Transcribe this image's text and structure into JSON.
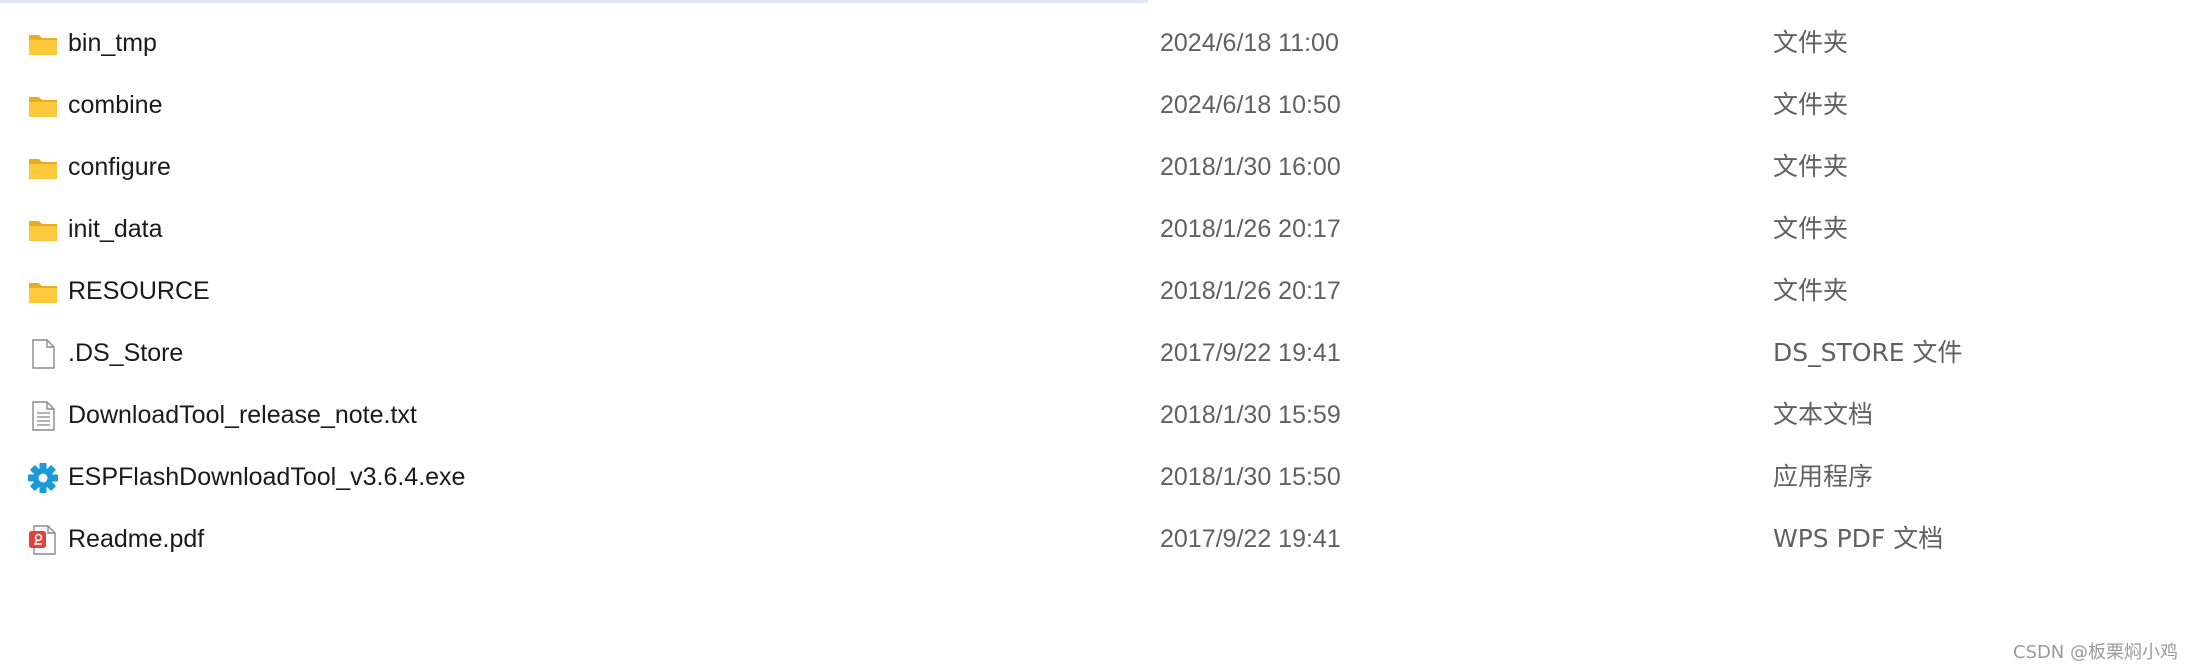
{
  "files": [
    {
      "name": "bin_tmp",
      "date": "2024/6/18 11:00",
      "type": "文件夹",
      "icon": "folder-icon"
    },
    {
      "name": "combine",
      "date": "2024/6/18 10:50",
      "type": "文件夹",
      "icon": "folder-icon"
    },
    {
      "name": "configure",
      "date": "2018/1/30 16:00",
      "type": "文件夹",
      "icon": "folder-icon"
    },
    {
      "name": "init_data",
      "date": "2018/1/26 20:17",
      "type": "文件夹",
      "icon": "folder-icon"
    },
    {
      "name": "RESOURCE",
      "date": "2018/1/26 20:17",
      "type": "文件夹",
      "icon": "folder-icon"
    },
    {
      "name": ".DS_Store",
      "date": "2017/9/22 19:41",
      "type": "DS_STORE 文件",
      "icon": "blank-file-icon"
    },
    {
      "name": "DownloadTool_release_note.txt",
      "date": "2018/1/30 15:59",
      "type": "文本文档",
      "icon": "text-file-icon"
    },
    {
      "name": "ESPFlashDownloadTool_v3.6.4.exe",
      "date": "2018/1/30 15:50",
      "type": "应用程序",
      "icon": "gear-icon"
    },
    {
      "name": "Readme.pdf",
      "date": "2017/9/22 19:41",
      "type": "WPS PDF 文档",
      "icon": "pdf-file-icon"
    }
  ],
  "watermark": "CSDN @板栗焖小鸡",
  "colors": {
    "folder": "#ffc93d",
    "gear": "#1a9ad6",
    "pdf": "#e5403a",
    "secondary_text": "#616161"
  }
}
